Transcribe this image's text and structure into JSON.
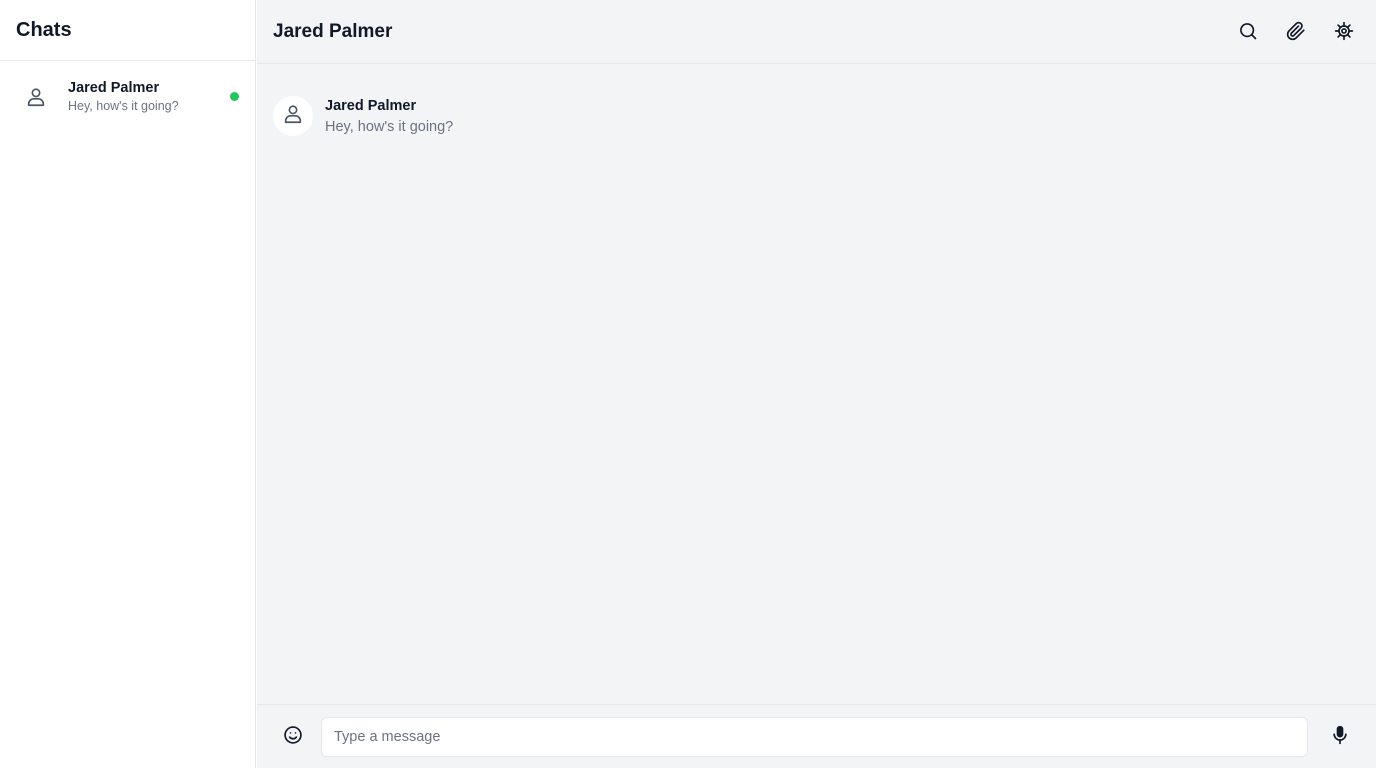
{
  "sidebar": {
    "title": "Chats",
    "chats": [
      {
        "name": "Jared Palmer",
        "preview": "Hey, how's it going?",
        "status": "online"
      }
    ]
  },
  "conversation": {
    "title": "Jared Palmer",
    "actions": [
      {
        "icon": "search-icon"
      },
      {
        "icon": "paperclip-icon"
      },
      {
        "icon": "settings-icon"
      }
    ],
    "messages": [
      {
        "sender": "Jared Palmer",
        "text": "Hey, how's it going?"
      }
    ]
  },
  "composer": {
    "placeholder": "Type a message",
    "value": "",
    "emoji_icon": "smiley-icon",
    "mic_icon": "microphone-icon"
  },
  "colors": {
    "online": "#22c55e",
    "background_main": "#f3f4f6",
    "border": "#e5e7eb",
    "muted_text": "#6b7280"
  }
}
